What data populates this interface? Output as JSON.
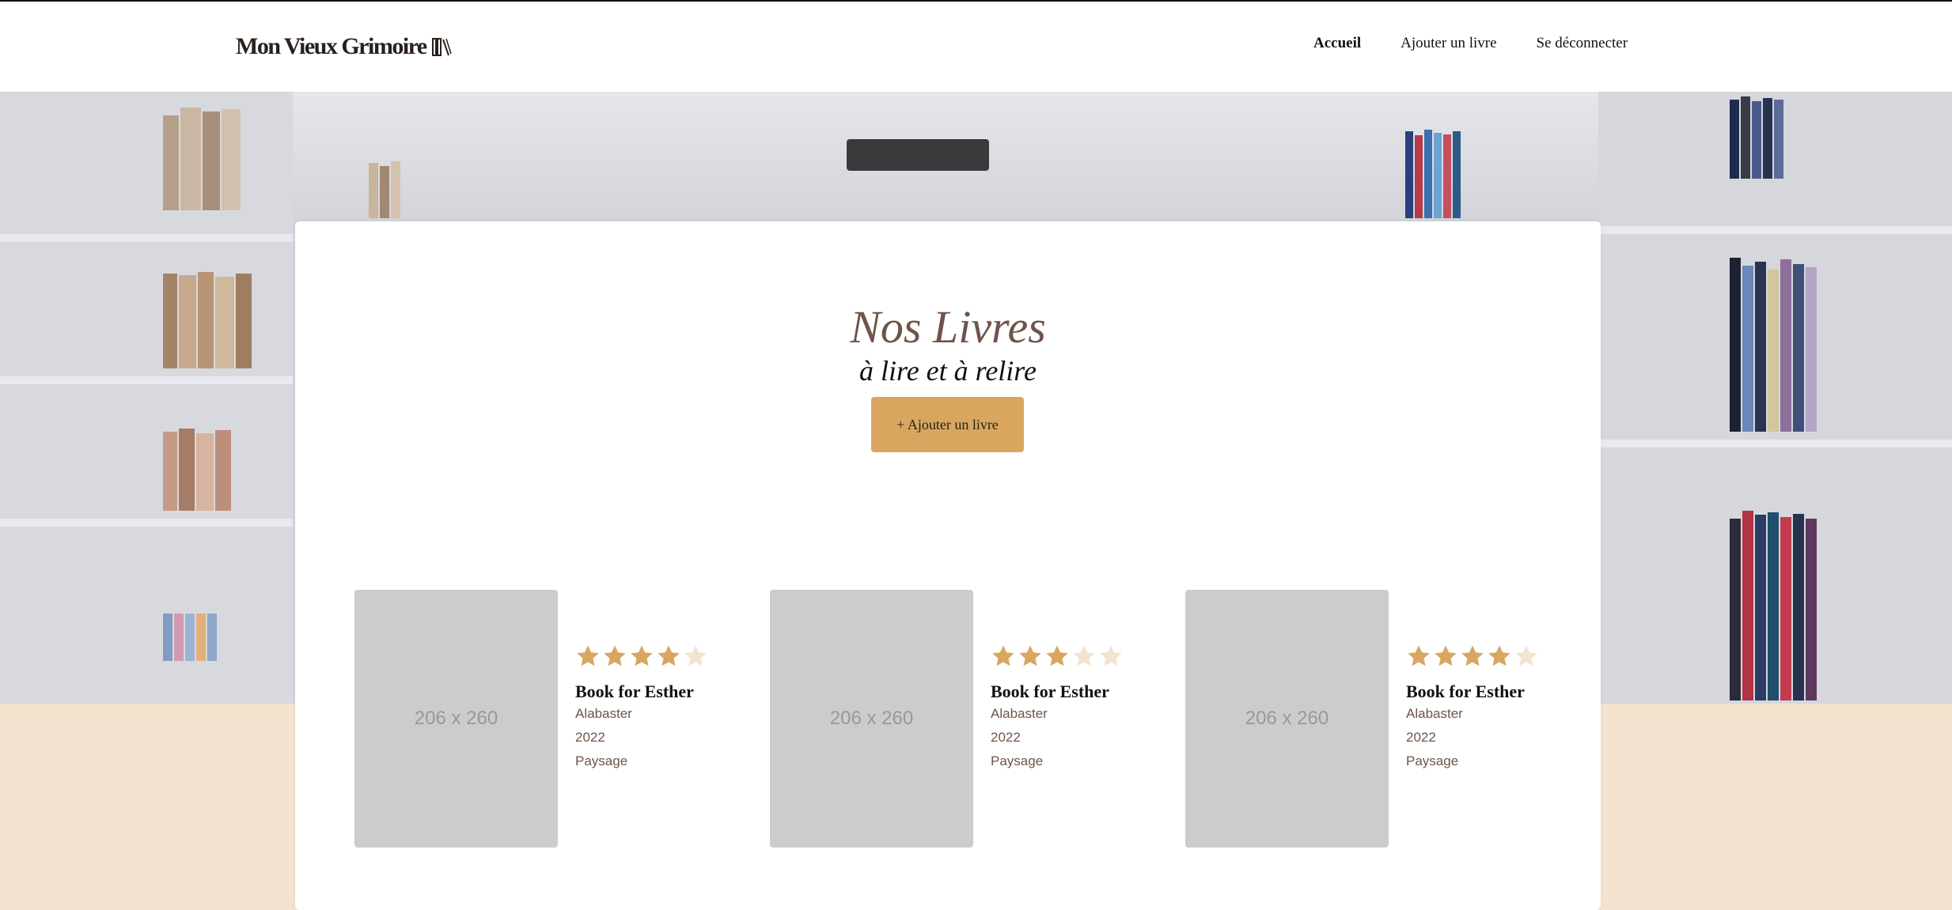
{
  "header": {
    "logo_text": "Mon Vieux Grimoire",
    "logo_icon": "books-icon",
    "nav": [
      {
        "label": "Accueil",
        "active": true
      },
      {
        "label": "Ajouter un livre",
        "active": false
      },
      {
        "label": "Se déconnecter",
        "active": false
      }
    ]
  },
  "main": {
    "title": "Nos Livres",
    "subtitle": "à lire et à relire",
    "add_button": "+ Ajouter un livre"
  },
  "books": [
    {
      "cover_text": "206 x 260",
      "rating": 4,
      "max_rating": 5,
      "title": "Book for Esther",
      "author": "Alabaster",
      "year": "2022",
      "genre": "Paysage"
    },
    {
      "cover_text": "206 x 260",
      "rating": 3,
      "max_rating": 5,
      "title": "Book for Esther",
      "author": "Alabaster",
      "year": "2022",
      "genre": "Paysage"
    },
    {
      "cover_text": "206 x 260",
      "rating": 4,
      "max_rating": 5,
      "title": "Book for Esther",
      "author": "Alabaster",
      "year": "2022",
      "genre": "Paysage"
    }
  ],
  "colors": {
    "accent": "#d9a65f",
    "star_filled": "#d9a65f",
    "star_empty": "#f3e3cf",
    "title_brown": "#6e5449",
    "page_bg": "#f3e3cf"
  }
}
